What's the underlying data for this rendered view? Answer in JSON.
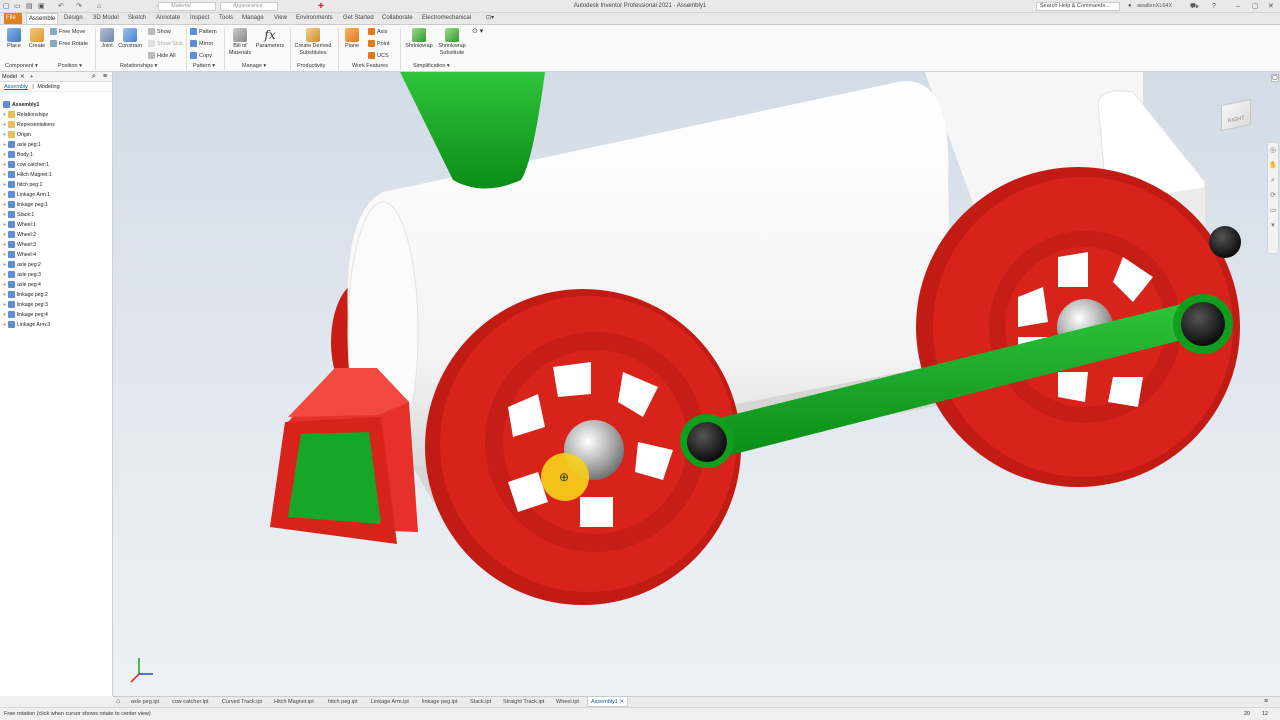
{
  "app_title": "Autodesk Inventor Professional 2021 · Assembly1",
  "qat": {
    "material": "Material",
    "appearance": "Appearance",
    "search_placeholder": "Search Help & Commands...",
    "user": "awallenXL64X"
  },
  "tabs": [
    "File",
    "Assemble",
    "Design",
    "3D Model",
    "Sketch",
    "Annotate",
    "Inspect",
    "Tools",
    "Manage",
    "View",
    "Environments",
    "Get Started",
    "Collaborate",
    "Electromechanical"
  ],
  "active_tab": "Assemble",
  "ribbon": {
    "place": "Place",
    "create": "Create",
    "free_move": "Free Move",
    "free_rotate": "Free Rotate",
    "joint": "Joint",
    "constrain": "Constrain",
    "show": "Show",
    "show_sick": "Show Sick",
    "hide_all": "Hide All",
    "pattern": "Pattern",
    "mirror": "Mirror",
    "copy": "Copy",
    "bom_1": "Bill of",
    "bom_2": "Materials",
    "parameters": "Parameters",
    "derived_1": "Create Derived",
    "derived_2": "Substitutes",
    "plane": "Plane",
    "axis": "Axis",
    "point": "Point",
    "ucs": "UCS",
    "shrinkwrap": "Shrinkwrap",
    "shrink_sub_1": "Shrinkwrap",
    "shrink_sub_2": "Substitute",
    "groups": {
      "component": "Component ▾",
      "position": "Position ▾",
      "relationships": "Relationships ▾",
      "pattern": "Pattern ▾",
      "manage": "Manage ▾",
      "productivity": "Productivity",
      "work_features": "Work Features",
      "simplification": "Simplification ▾"
    }
  },
  "browser": {
    "panel_title": "Model",
    "subtab_assembly": "Assembly",
    "subtab_modeling": "Modeling",
    "root": "Assembly1",
    "items": [
      {
        "label": "Relationships",
        "kind": "folder"
      },
      {
        "label": "Representations",
        "kind": "folder"
      },
      {
        "label": "Origin",
        "kind": "folder"
      },
      {
        "label": "axle peg:1",
        "kind": "part"
      },
      {
        "label": "Body:1",
        "kind": "part"
      },
      {
        "label": "cow catcher:1",
        "kind": "part"
      },
      {
        "label": "Hitch Magnet:1",
        "kind": "part"
      },
      {
        "label": "hitch peg:1",
        "kind": "part"
      },
      {
        "label": "Linkage Arm:1",
        "kind": "part"
      },
      {
        "label": "linkage peg:1",
        "kind": "part"
      },
      {
        "label": "Stack:1",
        "kind": "part"
      },
      {
        "label": "Wheel:1",
        "kind": "part"
      },
      {
        "label": "Wheel:2",
        "kind": "part"
      },
      {
        "label": "Wheel:3",
        "kind": "part"
      },
      {
        "label": "Wheel:4",
        "kind": "part"
      },
      {
        "label": "axle peg:2",
        "kind": "part"
      },
      {
        "label": "axle peg:3",
        "kind": "part"
      },
      {
        "label": "axle peg:4",
        "kind": "part"
      },
      {
        "label": "linkage peg:2",
        "kind": "part"
      },
      {
        "label": "linkage peg:3",
        "kind": "part"
      },
      {
        "label": "linkage peg:4",
        "kind": "part"
      },
      {
        "label": "Linkage Arm:3",
        "kind": "part"
      }
    ]
  },
  "viewcube_label": "RIGHT",
  "doc_tabs": [
    "axle peg.ipt",
    "cow catcher.ipt",
    "Curved Track.ipt",
    "Hitch Magnet.ipt",
    "hitch peg.ipt",
    "Linkage Arm.ipt",
    "linkage peg.ipt",
    "Stack.ipt",
    "Straight Track.ipt",
    "Wheel.ipt",
    "Assembly1"
  ],
  "active_doc": "Assembly1",
  "status_text": "Free rotation (click when cursor shows rotate to center view)",
  "status_counts": [
    "20",
    "12"
  ],
  "colors": {
    "red": "#d8231b",
    "green": "#0d9e1b",
    "accent": "#e37f1d"
  }
}
